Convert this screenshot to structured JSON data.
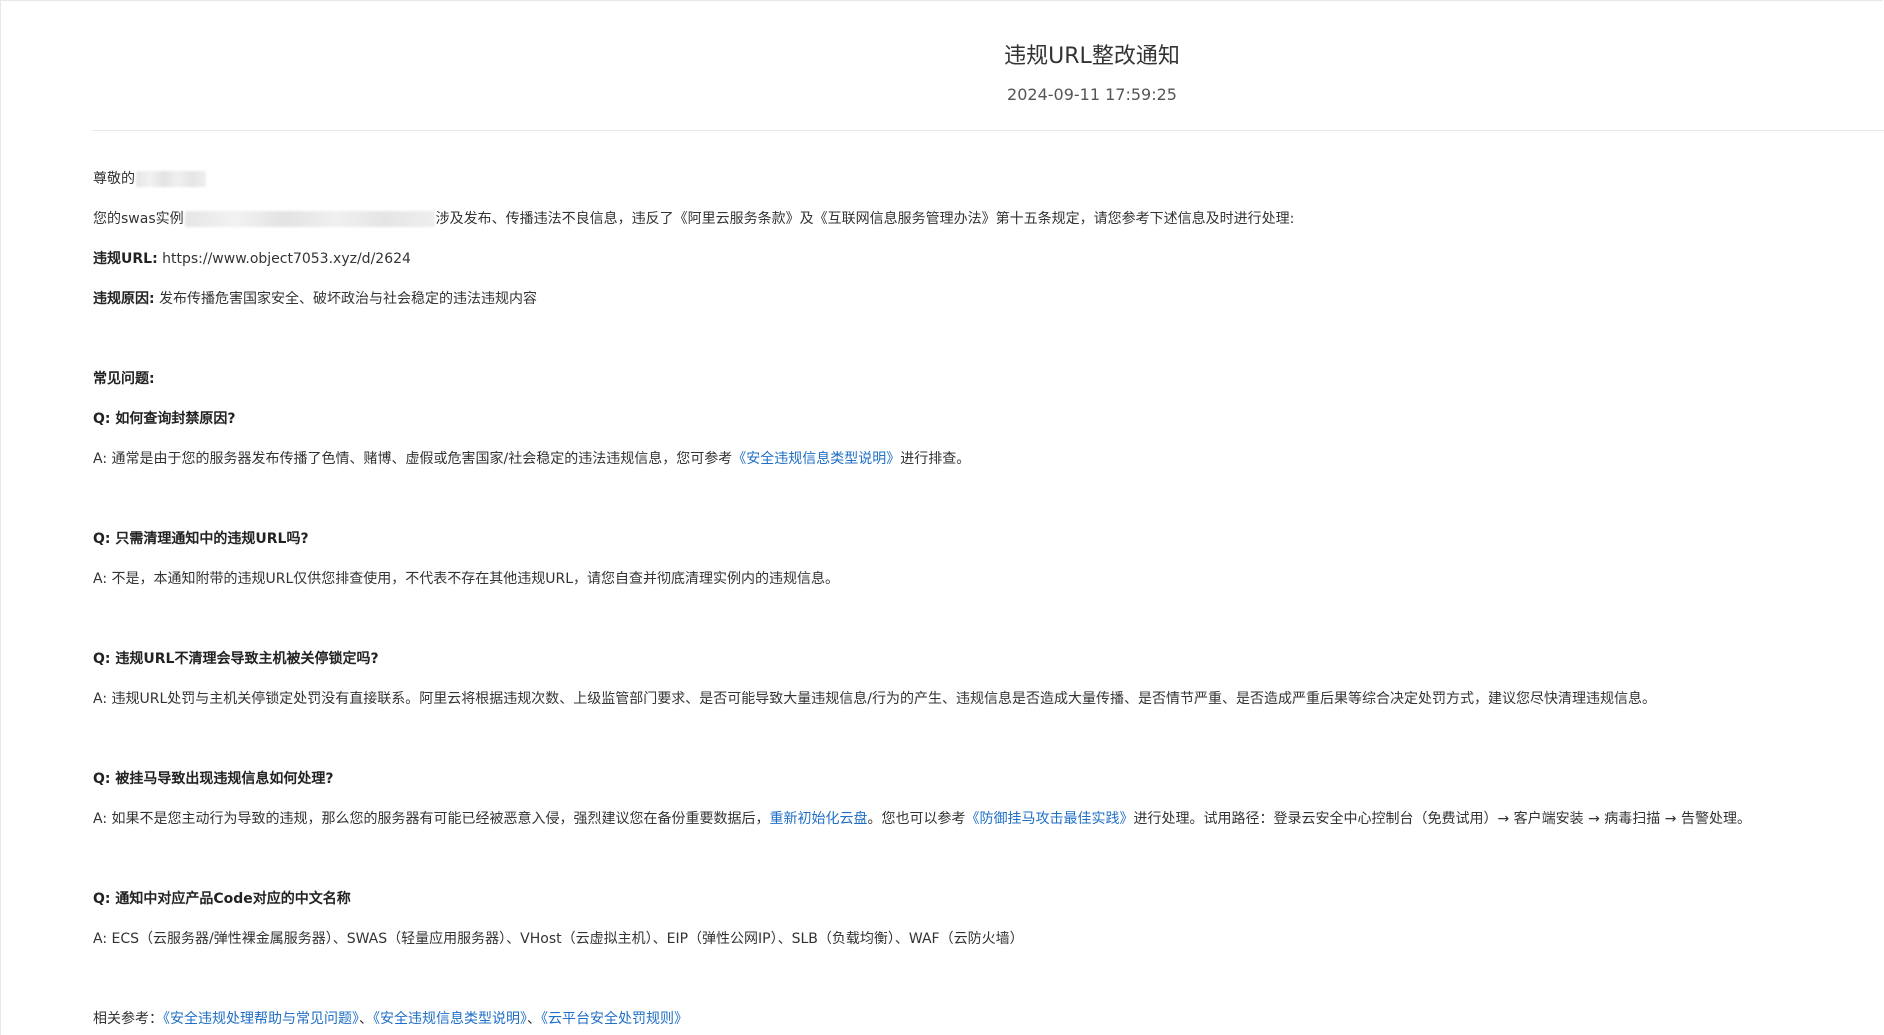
{
  "notice": {
    "title": "违规URL整改通知",
    "datetime": "2024-09-11 17:59:25"
  },
  "body": {
    "greeting": "尊敬的",
    "intro_prefix": "您的swas实例",
    "intro_suffix": "涉及发布、传播违法不良信息，违反了《阿里云服务条款》及《互联网信息服务管理办法》第十五条规定，请您参考下述信息及时进行处理:",
    "url_label": "违规URL:",
    "url_value": " https://www.object7053.xyz/d/2624",
    "reason_label": "违规原因:",
    "reason_value": " 发布传播危害国家安全、破坏政治与社会稳定的违法违规内容"
  },
  "faq": {
    "heading": "常见问题:",
    "q1": "Q: 如何查询封禁原因?",
    "a1_prefix": "A: 通常是由于您的服务器发布传播了色情、赌博、虚假或危害国家/社会稳定的违法违规信息，您可参考",
    "a1_link": "《安全违规信息类型说明》",
    "a1_suffix": "进行排查。",
    "q2": "Q: 只需清理通知中的违规URL吗?",
    "a2": "A: 不是，本通知附带的违规URL仅供您排查使用，不代表不存在其他违规URL，请您自查并彻底清理实例内的违规信息。",
    "q3": "Q: 违规URL不清理会导致主机被关停锁定吗?",
    "a3": "A: 违规URL处罚与主机关停锁定处罚没有直接联系。阿里云将根据违规次数、上级监管部门要求、是否可能导致大量违规信息/行为的产生、违规信息是否造成大量传播、是否情节严重、是否造成严重后果等综合决定处罚方式，建议您尽快清理违规信息。",
    "q4": "Q: 被挂马导致出现违规信息如何处理?",
    "a4_prefix": "A: 如果不是您主动行为导致的违规，那么您的服务器有可能已经被恶意入侵，强烈建议您在备份重要数据后，",
    "a4_link1": "重新初始化云盘",
    "a4_mid": "。您也可以参考",
    "a4_link2": "《防御挂马攻击最佳实践》",
    "a4_suffix": "进行处理。试用路径：登录云安全中心控制台（免费试用）→ 客户端安装 → 病毒扫描 → 告警处理。",
    "q5": "Q: 通知中对应产品Code对应的中文名称",
    "a5": "A: ECS（云服务器/弹性裸金属服务器）、SWAS（轻量应用服务器）、VHost（云虚拟主机）、EIP（弹性公网IP）、SLB（负载均衡）、WAF（云防火墙）"
  },
  "references": {
    "label": "相关参考：",
    "link1": "《安全违规处理帮助与常见问题》",
    "sep1": "、",
    "link2": "《安全违规信息类型说明》",
    "sep2": "、",
    "link3": "《云平台安全处罚规则》"
  }
}
